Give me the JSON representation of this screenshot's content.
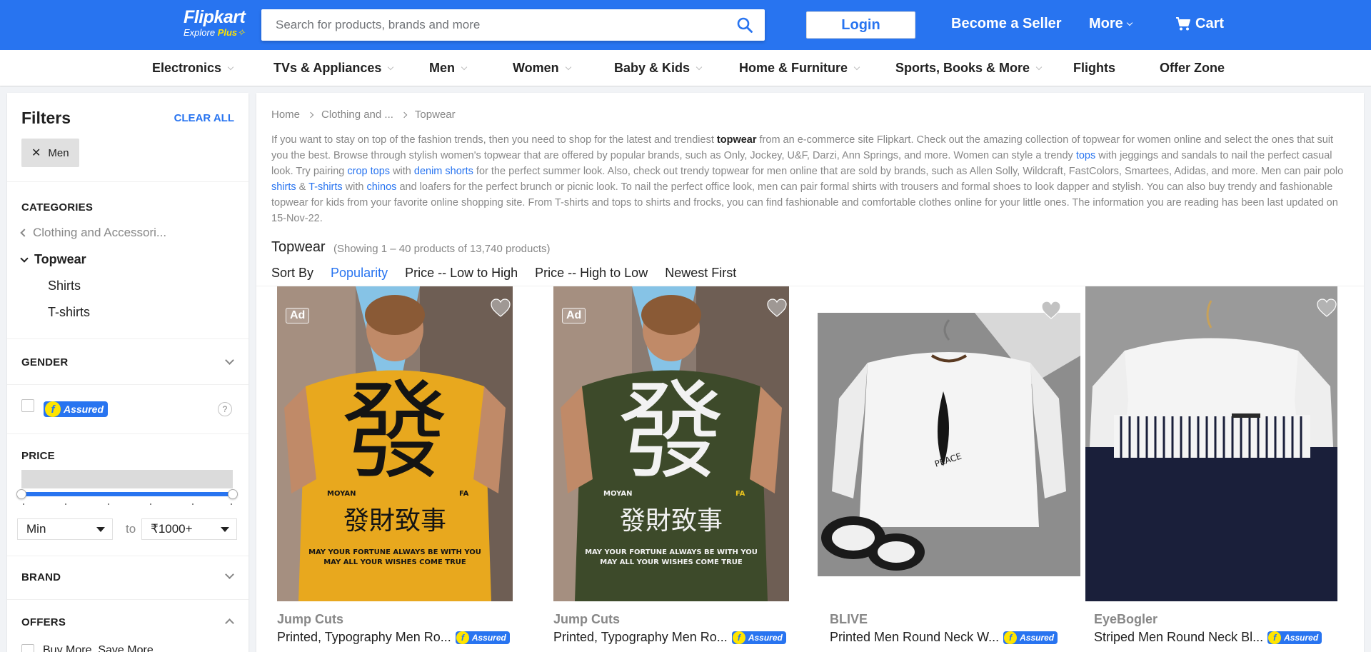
{
  "header": {
    "logo_name": "Flipkart",
    "logo_explore": "Explore",
    "logo_plus": "Plus",
    "search_placeholder": "Search for products, brands and more",
    "login_label": "Login",
    "seller_label": "Become a Seller",
    "more_label": "More",
    "cart_label": "Cart"
  },
  "nav": {
    "items": [
      {
        "label": "Electronics",
        "dropdown": true
      },
      {
        "label": "TVs & Appliances",
        "dropdown": true
      },
      {
        "label": "Men",
        "dropdown": true
      },
      {
        "label": "Women",
        "dropdown": true
      },
      {
        "label": "Baby & Kids",
        "dropdown": true
      },
      {
        "label": "Home & Furniture",
        "dropdown": true
      },
      {
        "label": "Sports, Books & More",
        "dropdown": true
      },
      {
        "label": "Flights",
        "dropdown": false
      },
      {
        "label": "Offer Zone",
        "dropdown": false
      }
    ]
  },
  "sidebar": {
    "title": "Filters",
    "clear_all": "CLEAR ALL",
    "chip_label": "Men",
    "categories_title": "CATEGORIES",
    "category_parent": "Clothing and Accessori...",
    "category_current": "Topwear",
    "subcategories": [
      "Shirts",
      "T-shirts"
    ],
    "gender_title": "GENDER",
    "assured_label": "Assured",
    "assured_f": "f",
    "help_mark": "?",
    "price_title": "PRICE",
    "price_min": "Min",
    "price_to": "to",
    "price_max": "₹1000+",
    "brand_title": "BRAND",
    "offers_title": "OFFERS",
    "offer_option": "Buy More, Save More"
  },
  "main": {
    "breadcrumbs": [
      "Home",
      "Clothing and ...",
      "Topwear"
    ],
    "description": {
      "p1": "If you want to stay on top of the fashion trends, then you need to shop for the latest and trendiest ",
      "b1": "topwear",
      "p2": " from an e-commerce site Flipkart. Check out the amazing collection of topwear for women online and select the ones that suit you the best. Browse through stylish women's topwear that are offered by popular brands, such as Only, Jockey, U&F, Darzi, Ann Springs, and more. Women can style a trendy ",
      "l1": "tops",
      "p3": " with jeggings and sandals to nail the perfect casual look. Try pairing ",
      "l2": "crop tops",
      "p4": " with ",
      "l3": "denim shorts",
      "p5": " for the perfect summer look. Also, check out trendy topwear for men online that are sold by brands, such as Allen Solly, Wildcraft, FastColors, Smartees, Adidas, and more. Men can pair polo ",
      "l4": "shirts",
      "p6": " & ",
      "l5": "T-shirts",
      "p7": " with ",
      "l6": "chinos",
      "p8": " and loafers for the perfect brunch or picnic look. To nail the perfect office look, men can pair formal shirts with trousers and formal shoes to look dapper and stylish. You can also buy trendy and fashionable topwear for kids from your favorite online shopping site. From T-shirts and tops to shirts and frocks, you can find fashionable and comfortable clothes online for your little ones. The information you are reading has been last updated on 15-Nov-22."
    },
    "title": "Topwear",
    "count_text": "(Showing 1 – 40 products of 13,740 products)",
    "sort_label": "Sort By",
    "sort_options": [
      "Popularity",
      "Price -- Low to High",
      "Price -- High to Low",
      "Newest First"
    ],
    "sort_active": "Popularity",
    "products": [
      {
        "brand": "Jump Cuts",
        "name": "Printed, Typography Men Ro...",
        "ad": "Ad",
        "assured": "Assured",
        "colors": {
          "shirt": "#e8a81e",
          "bg": "#7e6f66"
        }
      },
      {
        "brand": "Jump Cuts",
        "name": "Printed, Typography Men Ro...",
        "ad": "Ad",
        "assured": "Assured",
        "colors": {
          "shirt": "#3d4a2a",
          "bg": "#7e6f66"
        }
      },
      {
        "brand": "BLIVE",
        "name": "Printed Men Round Neck W...",
        "ad": "",
        "assured": "Assured",
        "colors": {
          "shirt": "#f4f4f4",
          "bg": "#8f8f8f"
        }
      },
      {
        "brand": "EyeBogler",
        "name": "Striped Men Round Neck Bl...",
        "ad": "",
        "assured": "Assured",
        "colors": {
          "shirt": "#1a1f3a",
          "bg": "#9a9a9a"
        }
      }
    ],
    "print_text": {
      "glyph": "發",
      "sub_glyph": "發財致事",
      "brand_tag": "MOYAN",
      "corner_tag": "FA",
      "line1": "MAY YOUR FORTUNE ALWAYS BE WITH YOU",
      "line2": "MAY ALL YOUR WISHES COME TRUE",
      "peace": "PEACE"
    }
  },
  "colors": {
    "brand_blue": "#2874f0",
    "yellow": "#ffe500",
    "muted": "#878787"
  }
}
